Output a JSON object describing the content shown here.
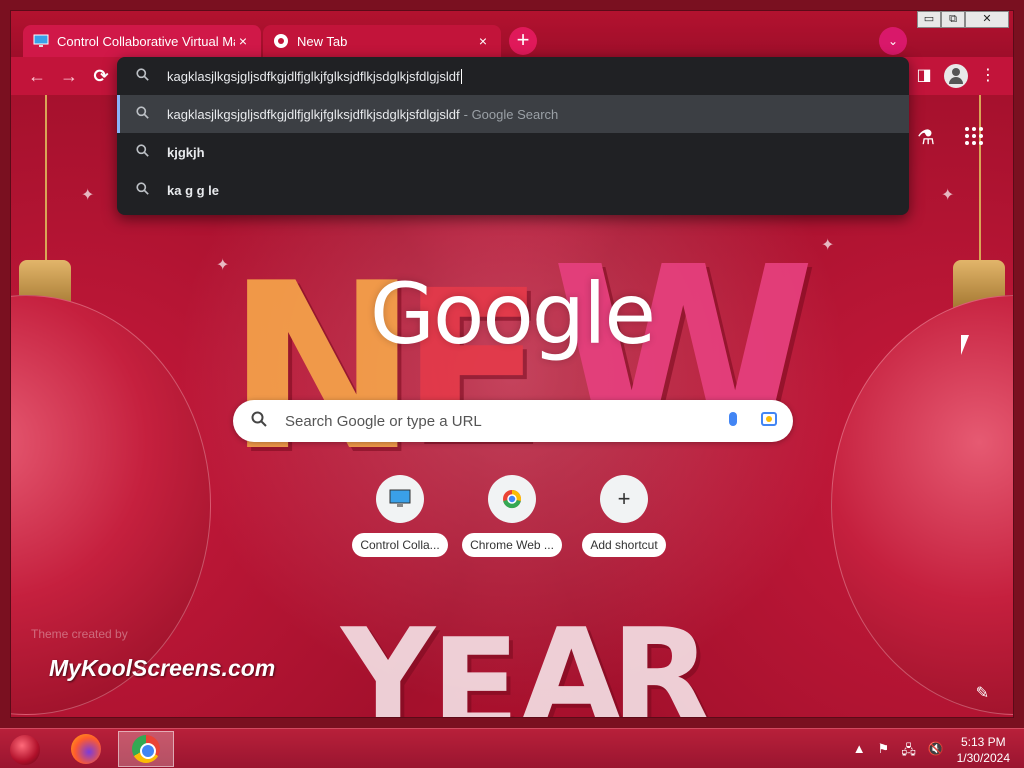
{
  "window": {
    "tabs": [
      {
        "label": "Control Collaborative Virtual Ma",
        "close": "×"
      },
      {
        "label": "New Tab",
        "close": "×"
      }
    ],
    "new_tab_glyph": "+",
    "tab_search_glyph": "⌄",
    "controls": {
      "minimize": "▭",
      "maximize": "⧉",
      "close": "✕"
    }
  },
  "toolbar": {
    "back_glyph": "←",
    "forward_glyph": "→",
    "reload_glyph": "⟳",
    "side_panel_glyph": "◨",
    "menu_glyph": "⋮"
  },
  "omnibox": {
    "input_value": "kagklasjlkgsjgljsdfkgjdlfjglkjfglksjdflkjsdglkjsfdlgjsldf",
    "suggestions": [
      {
        "text": "kagklasjlkgsjgljsdfkgjdlfjglkjfglksjdflkjsdglkjsfdlgjsldf",
        "suffix": "- Google Search",
        "selected": true
      },
      {
        "text": "kjgkjh",
        "suffix": "",
        "selected": false
      },
      {
        "text": "ka g g le",
        "suffix": "",
        "selected": false
      }
    ]
  },
  "ntp": {
    "logo_text": "Google",
    "search_placeholder": "Search Google or type a URL",
    "shortcuts": [
      {
        "label": "Control Colla...",
        "icon": "monitor-icon"
      },
      {
        "label": "Chrome Web ...",
        "icon": "chrome-web-store-icon"
      },
      {
        "label": "Add shortcut",
        "icon": "plus-icon"
      }
    ],
    "theme_credit": "Theme created by",
    "theme_site": "MyKoolScreens.com",
    "theme_letters": [
      "N",
      "E",
      "W",
      "Y",
      "E",
      "A",
      "R"
    ],
    "customize_glyph": "✎",
    "labs_glyph": "⚗"
  },
  "taskbar": {
    "time": "5:13 PM",
    "date": "1/30/2024",
    "tray_glyphs": [
      "▲",
      "⚑",
      "🖧",
      "🔇"
    ]
  },
  "colors": {
    "theme_red": "#c2143a",
    "omnibox_bg": "#202124",
    "accent_blue": "#8ab4f8"
  }
}
